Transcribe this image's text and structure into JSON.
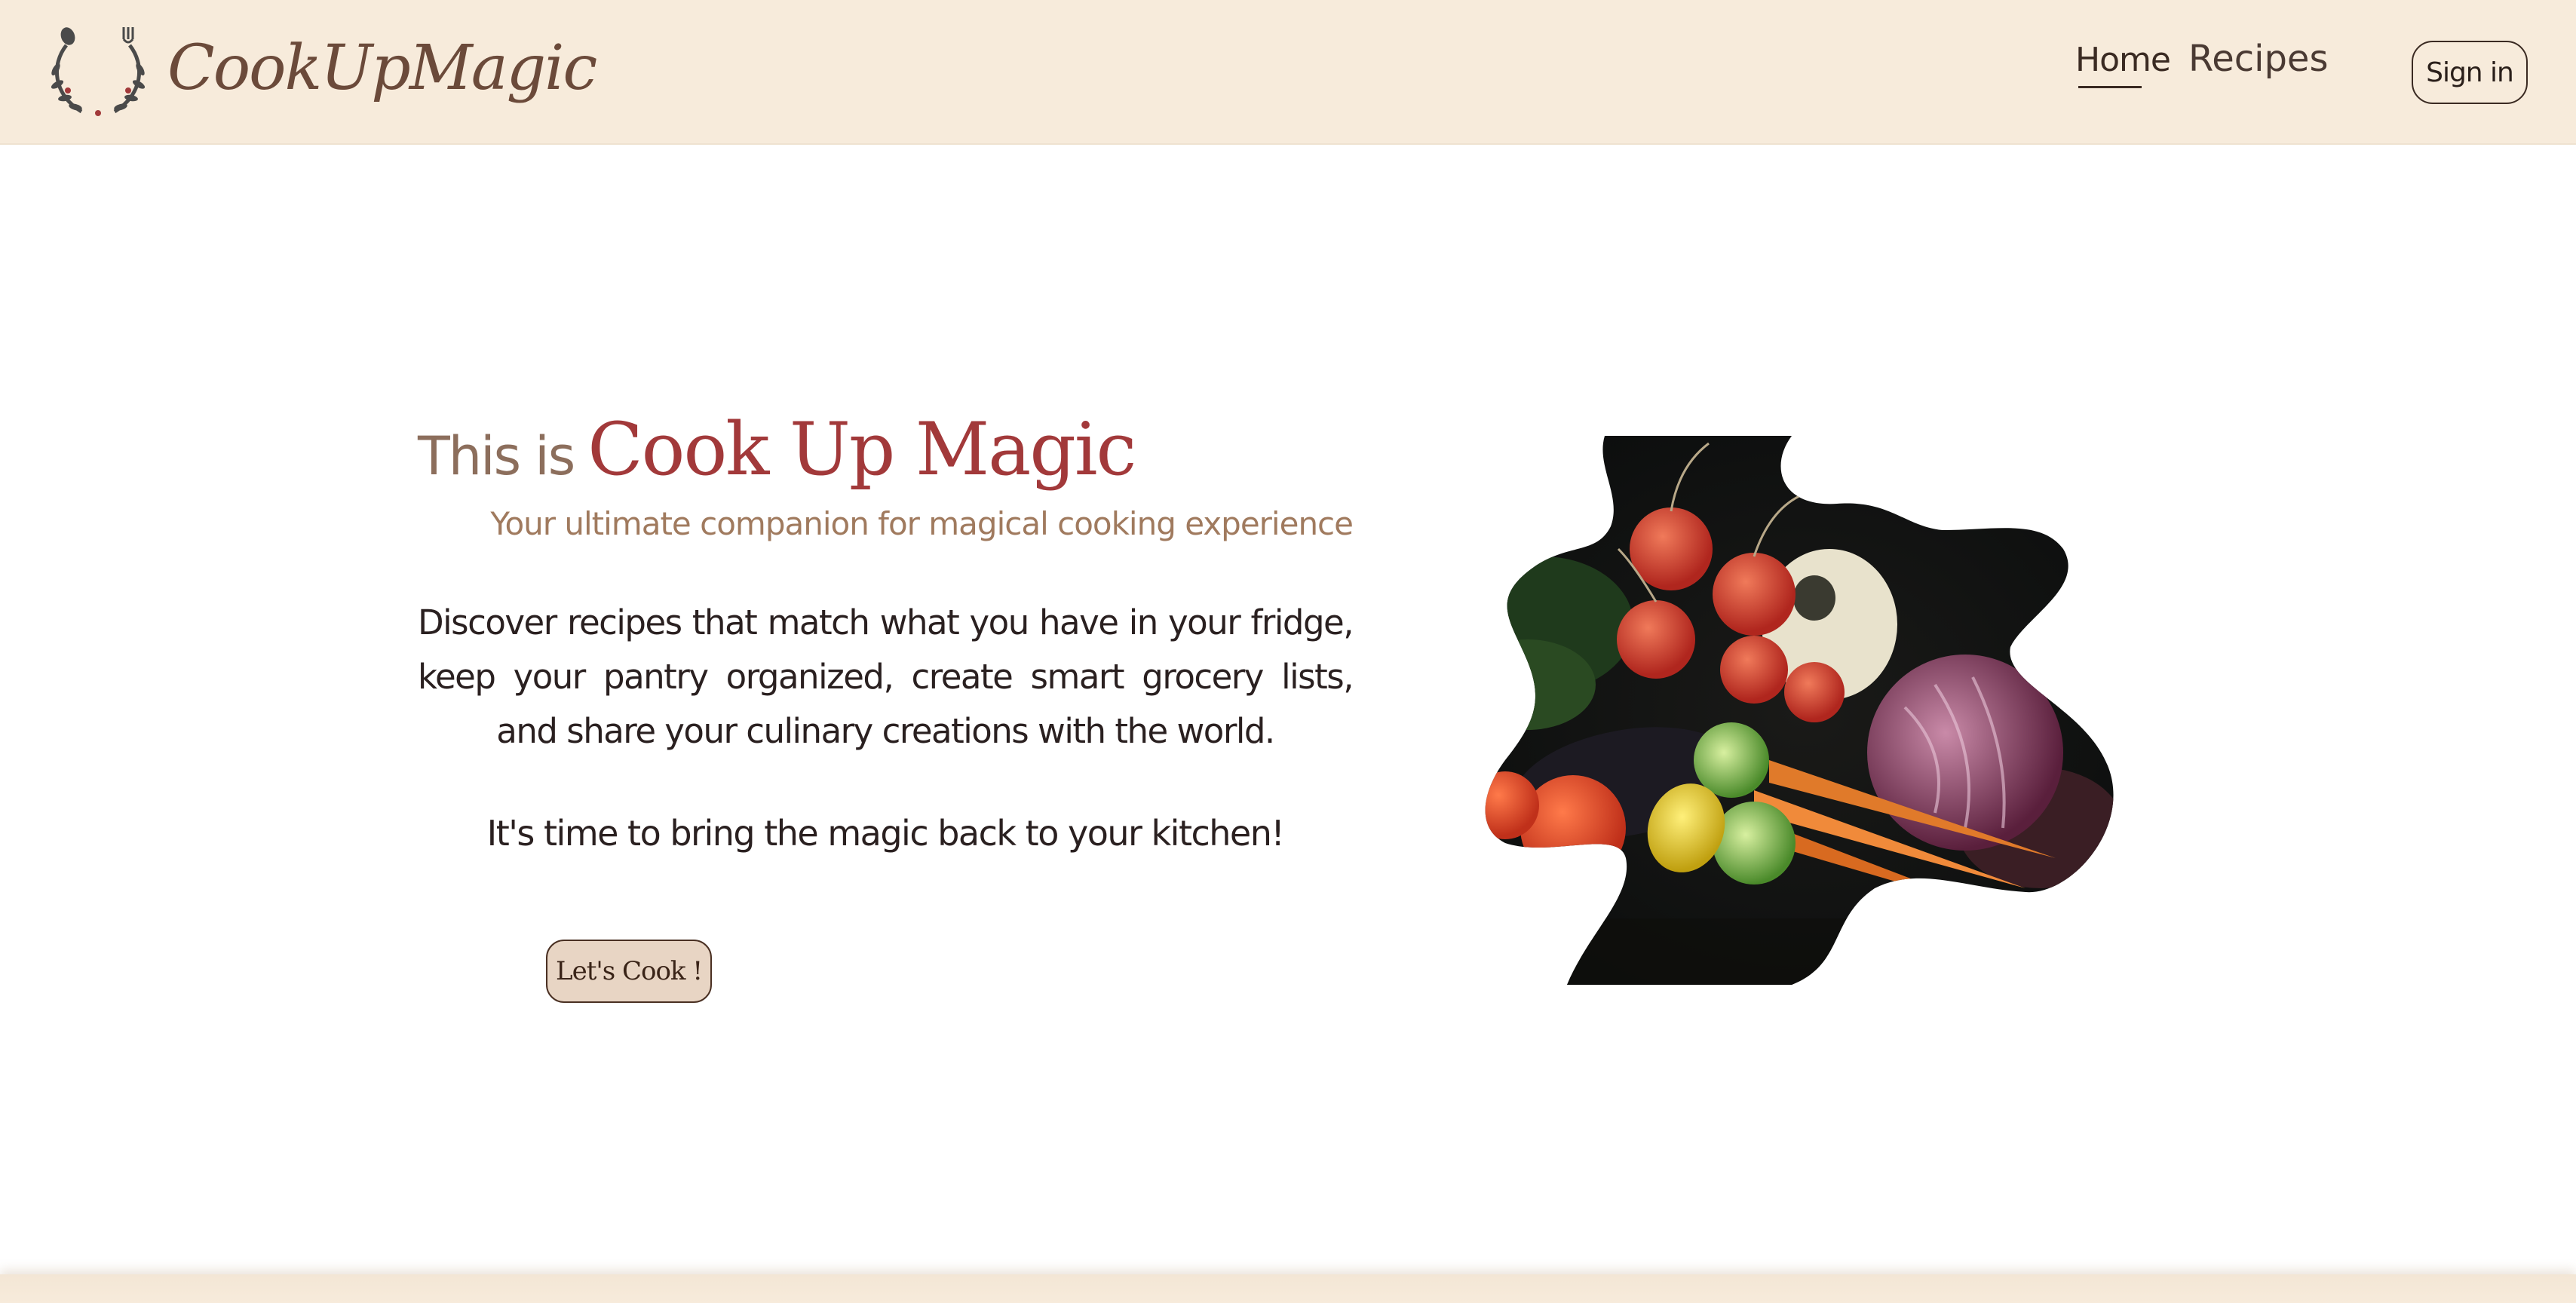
{
  "header": {
    "brand": "CookUpMagic",
    "nav": {
      "home_label": "Home",
      "recipes_label": "Recipes"
    },
    "signin_label": "Sign in",
    "background_color": "#f7ebdb"
  },
  "hero": {
    "title_prefix": "This is",
    "title_brand": "Cook Up Magic",
    "subtitle": "Your ultimate companion for magical cooking experience",
    "description": "Discover recipes that match what you have in your fridge, keep your pantry organized, create smart grocery lists, and share your culinary creations with the world.",
    "tagline": "It's time to bring the magic back to your kitchen!",
    "cta_label": "Let's Cook !",
    "image_icon": "vegetables-image"
  },
  "colors": {
    "accent_red": "#a2393a",
    "brown_text": "#8c6e5c",
    "button_bg": "#e8d5c4"
  }
}
